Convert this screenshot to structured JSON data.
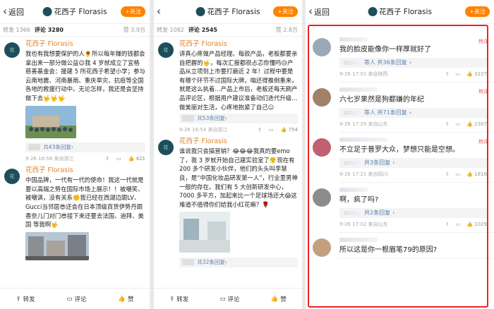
{
  "panel1": {
    "back": "返回",
    "brand": "花西子 Florasis",
    "follow": "+关注",
    "tabs": {
      "repost": "转发 1366",
      "comments": "评论 3280",
      "likes": "赞 3.9万"
    },
    "posts": [
      {
        "user": "花西子 Florasis",
        "text": "我也有我想要保护的人🌻所以每年赚的钱都会拿出来一部分做公益😉我 4 岁就成立了宜格慈善基金会：援建 5 所花西子希望小学；参与云南地震、河南暴雨、重庆旱灾、抗疫等全国各地的救援行动中。无论怎样，我还是会坚持做下去🤟🤟🤟",
        "replies": "共43条回复",
        "time": "9-26 16:56 来自浙江",
        "like": "421"
      },
      {
        "user": "花西子 Florasis",
        "text": "中国品牌，一代有一代的使命！我这一代就是要以高端之势在国际市场上展示！！被嘲笑、被嘲讽，没有关系🙂我已经在西湖边跟LV、Gucci当邻居😎还会在日本顶级百货伊势丹跟香奈儿门对门😎接下来还要去法国、迪拜、美国 等我啊🤟"
      }
    ],
    "bottom": {
      "repost": "转发",
      "comment": "评论",
      "like": "赞"
    }
  },
  "panel2": {
    "brand": "花西子 Florasis",
    "follow": "+关注",
    "tabs": {
      "repost": "转发 1082",
      "comments": "评论 2545",
      "likes": "赞 2.8万"
    },
    "posts": [
      {
        "user": "花西子 Florasis",
        "text": "讲真心疼做产品经理。每款产品，老板都要亲自把握的🤟，每次汇报都很忐忑你懂吗😥产品从立项到上市要打磨近 2 年！过程中要是有哪个环节不过国际大牌，咱还得推倒重来，就是这么执着…产品上市后，老板还每天刷产品评论区，根据用户建议准备动们迭代升级…做美丽对生活，心疼地抱紧了自己😑",
        "replies": "共53条回复",
        "time": "9-26 16:54 来自浙江",
        "like": "754"
      },
      {
        "user": "花西子 Florasis",
        "text": "谁说我只会搞营销？😂😂😂我真的要emo了，我 3 岁就开始自己建实验室了😤现在有 200 多个研发小伙伴，他们的头头叫李慧良，是“中国化妆品研发第一人”，行业里男神一般的存在。我们有 5 大创新研发中心，7000 多平方，加起来比一个足球场还大😱这难道不值得你们给我小红花嘛？🌹",
        "replies": "共32条回复"
      }
    ],
    "bottom": {
      "repost": "转发",
      "comment": "评论",
      "like": "赞"
    }
  },
  "panel3": {
    "back": "返回",
    "brand": "花西子 Florasis",
    "follow": "+关注",
    "hot_label": "热评",
    "comments": [
      {
        "text": "我的脸皮能像你一样厚就好了",
        "replies": "等人 共36条回复",
        "time": "9-26 17:01 来自陕西",
        "like": "3227",
        "hot": true,
        "avatar": "#9aa8b8"
      },
      {
        "text": "六七岁果然是狗都嫌的年纪",
        "replies": "等人 共71条回复",
        "time": "9-26 17:29 来自山东",
        "like": "2307",
        "hot": true,
        "avatar": "#a0826a"
      },
      {
        "text": "不立足于普罗大众，梦想只能是空想。",
        "replies": "共3条回复",
        "time": "9-26 17:21 来自四川",
        "like": "1816",
        "hot": true,
        "avatar": "#c06070"
      },
      {
        "text": "啊，疯了吗?",
        "replies": "共2条回复",
        "time": "9-26 17:02 来自山东",
        "like": "1029",
        "hot": false,
        "avatar": "#8c8c8c"
      },
      {
        "text": "所以这是你一根眉笔79的原因?",
        "hot": false,
        "avatar": "#c2a080"
      }
    ]
  }
}
